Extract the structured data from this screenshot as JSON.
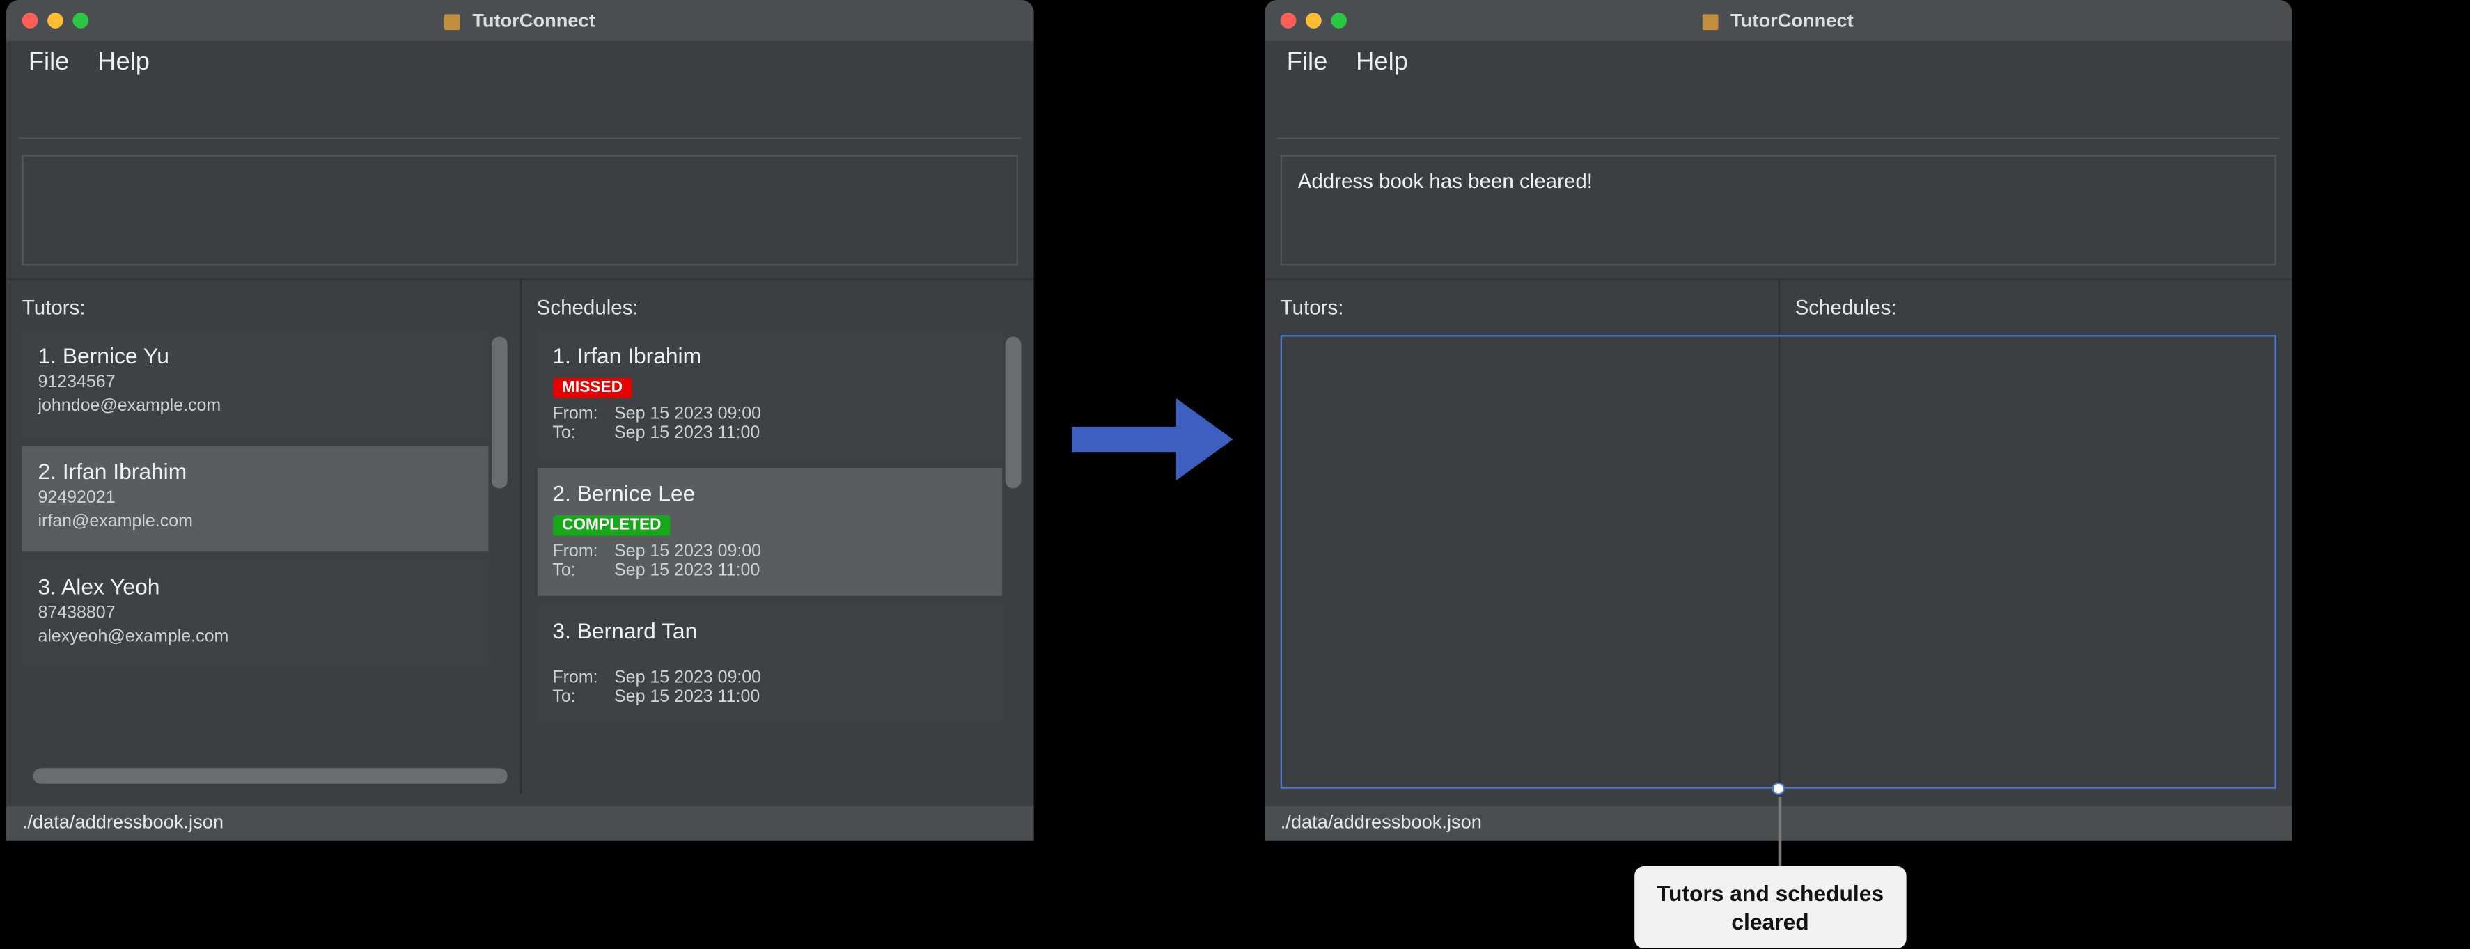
{
  "app_title": "TutorConnect",
  "menu": {
    "file": "File",
    "help": "Help"
  },
  "status_path": "./data/addressbook.json",
  "panel_headers": {
    "tutors": "Tutors:",
    "schedules": "Schedules:"
  },
  "left_window": {
    "output": "",
    "tutors": [
      {
        "idx": "1.",
        "name": "Bernice Yu",
        "phone": "91234567",
        "email": "johndoe@example.com",
        "selected": false
      },
      {
        "idx": "2.",
        "name": "Irfan Ibrahim",
        "phone": "92492021",
        "email": "irfan@example.com",
        "selected": true
      },
      {
        "idx": "3.",
        "name": "Alex Yeoh",
        "phone": "87438807",
        "email": "alexyeoh@example.com",
        "selected": false
      }
    ],
    "schedules": [
      {
        "idx": "1.",
        "name": "Irfan Ibrahim",
        "status": "MISSED",
        "status_kind": "missed",
        "from_label": "From:",
        "from": "Sep 15 2023 09:00",
        "to_label": "To:",
        "to": "Sep 15 2023 11:00",
        "selected": false
      },
      {
        "idx": "2.",
        "name": "Bernice Lee",
        "status": "COMPLETED",
        "status_kind": "completed",
        "from_label": "From:",
        "from": "Sep 15 2023 09:00",
        "to_label": "To:",
        "to": "Sep 15 2023 11:00",
        "selected": true
      },
      {
        "idx": "3.",
        "name": "Bernard Tan",
        "status": "",
        "status_kind": "",
        "from_label": "From:",
        "from": "Sep 15 2023 09:00",
        "to_label": "To:",
        "to": "Sep 15 2023 11:00",
        "selected": false
      }
    ]
  },
  "right_window": {
    "output": "Address book has been cleared!",
    "tutors": [],
    "schedules": []
  },
  "callout": "Tutors and schedules\ncleared"
}
